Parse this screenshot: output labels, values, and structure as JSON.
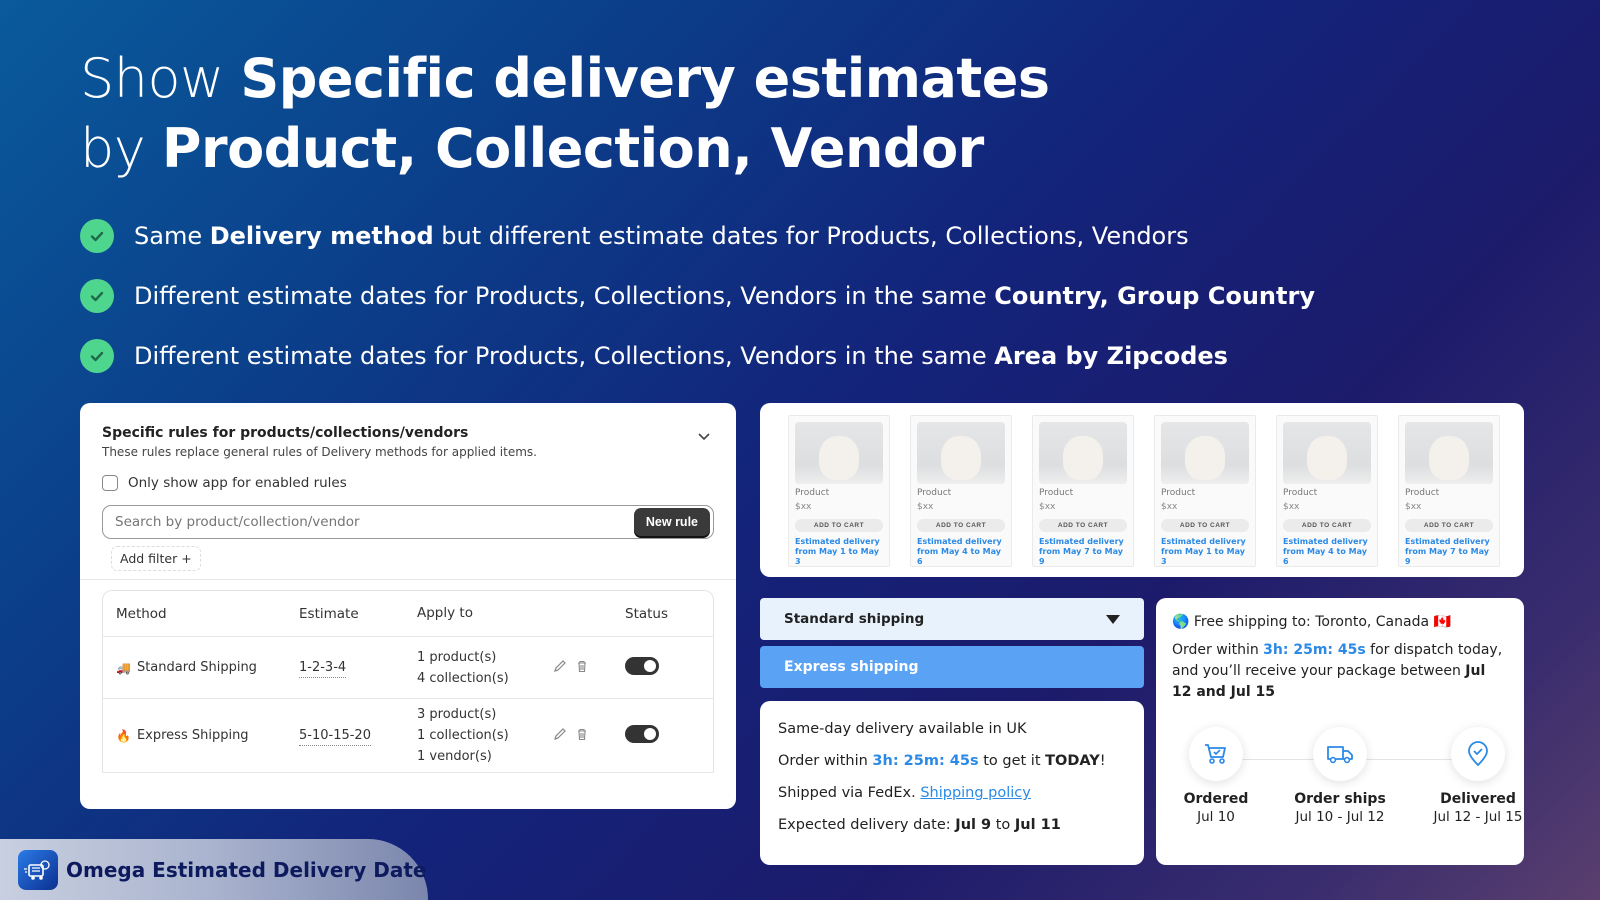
{
  "hero": {
    "line1_light": "Show ",
    "line1_bold": "Specific delivery estimates",
    "line2_light": "by ",
    "line2_bold": "Product, Collection, Vendor"
  },
  "bullets": [
    {
      "pre": "Same ",
      "bold": "Delivery method",
      "post": " but different estimate dates for Products, Collections, Vendors"
    },
    {
      "pre": "Different estimate dates for Products, Collections, Vendors in the same ",
      "bold": "Country, Group Country",
      "post": ""
    },
    {
      "pre": "Different estimate dates for Products, Collections, Vendors in the same ",
      "bold": "Area by Zipcodes",
      "post": ""
    }
  ],
  "admin": {
    "title": "Specific rules for products/collections/vendors",
    "subtitle": "These rules replace general rules of Delivery methods for applied items.",
    "checkbox_label": "Only show app for enabled rules",
    "search_placeholder": "Search by product/collection/vendor",
    "new_rule": "New rule",
    "add_filter": "Add filter +",
    "columns": {
      "method": "Method",
      "estimate": "Estimate",
      "apply": "Apply to",
      "status": "Status"
    },
    "rows": [
      {
        "icon": "🚚",
        "method": "Standard Shipping",
        "estimate": "1-2-3-4",
        "apply": [
          "1 product(s)",
          "4 collection(s)"
        ],
        "enabled": true
      },
      {
        "icon": "🔥",
        "method": "Express Shipping",
        "estimate": "5-10-15-20",
        "apply": [
          "3 product(s)",
          "1 collection(s)",
          "1 vendor(s)"
        ],
        "enabled": true
      }
    ]
  },
  "products": [
    {
      "name": "Product",
      "price": "$xx",
      "button": "ADD TO CART",
      "est1": "Estimated delivery",
      "est2": "from May 1 to May 3"
    },
    {
      "name": "Product",
      "price": "$xx",
      "button": "ADD TO CART",
      "est1": "Estimated delivery",
      "est2": "from May 4 to May 6"
    },
    {
      "name": "Product",
      "price": "$xx",
      "button": "ADD TO CART",
      "est1": "Estimated delivery",
      "est2": "from May 7 to May 9"
    },
    {
      "name": "Product",
      "price": "$xx",
      "button": "ADD TO CART",
      "est1": "Estimated delivery",
      "est2": "from May 1 to May 3"
    },
    {
      "name": "Product",
      "price": "$xx",
      "button": "ADD TO CART",
      "est1": "Estimated delivery",
      "est2": "from May 4 to May 6"
    },
    {
      "name": "Product",
      "price": "$xx",
      "button": "ADD TO CART",
      "est1": "Estimated delivery",
      "est2": "from May 7 to May 9"
    }
  ],
  "shipping_select": {
    "selected": "Standard shipping",
    "option_highlighted": "Express shipping"
  },
  "sameday": {
    "line1": "Same-day delivery available in UK",
    "line2_pre": "Order within ",
    "line2_timer": "3h: 25m: 45s",
    "line2_mid": " to get it ",
    "line2_bold": "TODAY",
    "line2_post": "!",
    "line3_pre": "Shipped via FedEx. ",
    "line3_link": "Shipping policy",
    "line4_pre": "Expected delivery date: ",
    "line4_d1": "Jul 9",
    "line4_mid": " to ",
    "line4_d2": "Jul 11"
  },
  "free": {
    "globe": "🌎",
    "line1": "Free shipping to: Toronto, Canada",
    "flag": "🇨🇦",
    "p_pre": "Order within ",
    "p_timer": "3h: 25m: 45s",
    "p_post": " for dispatch today, and you’ll receive your package between ",
    "p_dates": "Jul 12 and Jul 15",
    "steps": [
      {
        "label": "Ordered",
        "date": "Jul 10"
      },
      {
        "label": "Order ships",
        "date": "Jul 10 - Jul 12"
      },
      {
        "label": "Delivered",
        "date": "Jul 12 - Jul 15"
      }
    ]
  },
  "brand": {
    "name": "Omega Estimated Delivery Date"
  },
  "colors": {
    "accent": "#2b8ae6",
    "check": "#4fd68e",
    "express": "#5aa2f4"
  }
}
